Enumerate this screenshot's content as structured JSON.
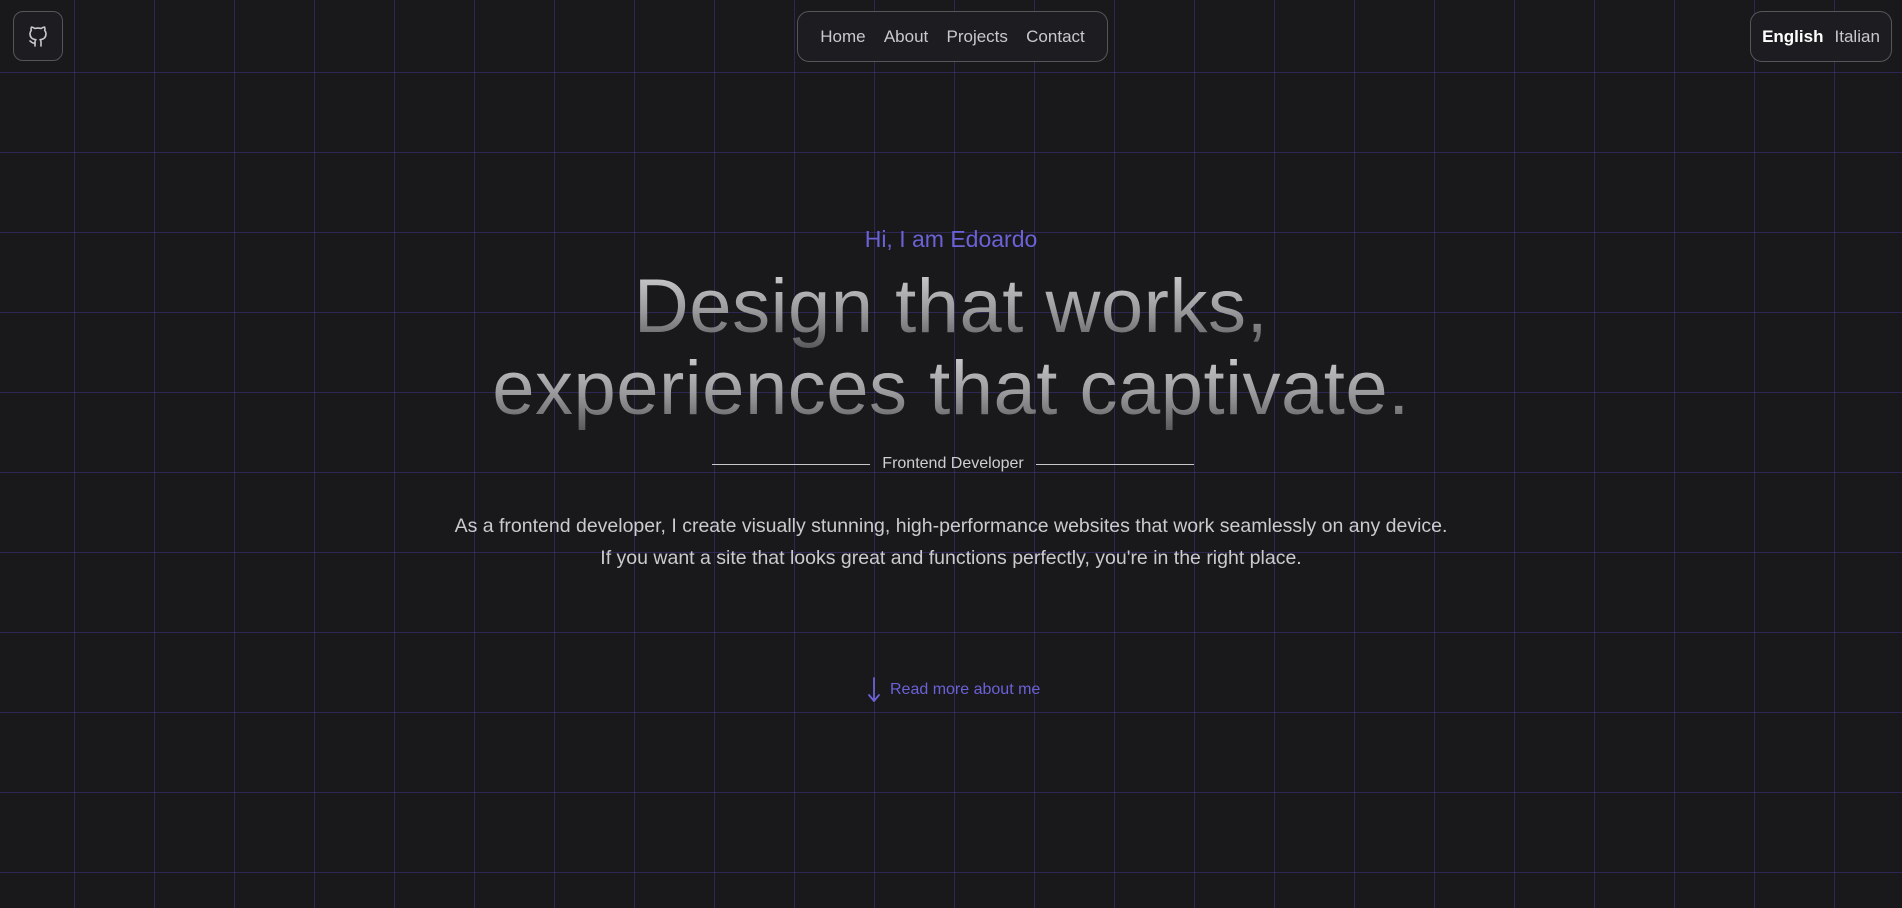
{
  "header": {
    "github_icon": "github-icon",
    "nav": [
      {
        "label": "Home"
      },
      {
        "label": "About"
      },
      {
        "label": "Projects"
      },
      {
        "label": "Contact"
      }
    ],
    "languages": [
      {
        "label": "English",
        "active": true
      },
      {
        "label": "Italian",
        "active": false
      }
    ]
  },
  "hero": {
    "greeting": "Hi, I am Edoardo",
    "headline_line1": "Design that works,",
    "headline_line2": "experiences that captivate.",
    "role": "Frontend Developer",
    "intro_line1": "As a frontend developer, I create visually stunning, high-performance websites that work seamlessly on any device.",
    "intro_line2": "If you want a site that looks great and functions perfectly, you're in the right place.",
    "read_more": "Read more about me",
    "read_more_icon": "arrow-down-icon"
  },
  "colors": {
    "background": "#19181b",
    "accent": "#6a62d6",
    "grid": "#3b3470"
  }
}
